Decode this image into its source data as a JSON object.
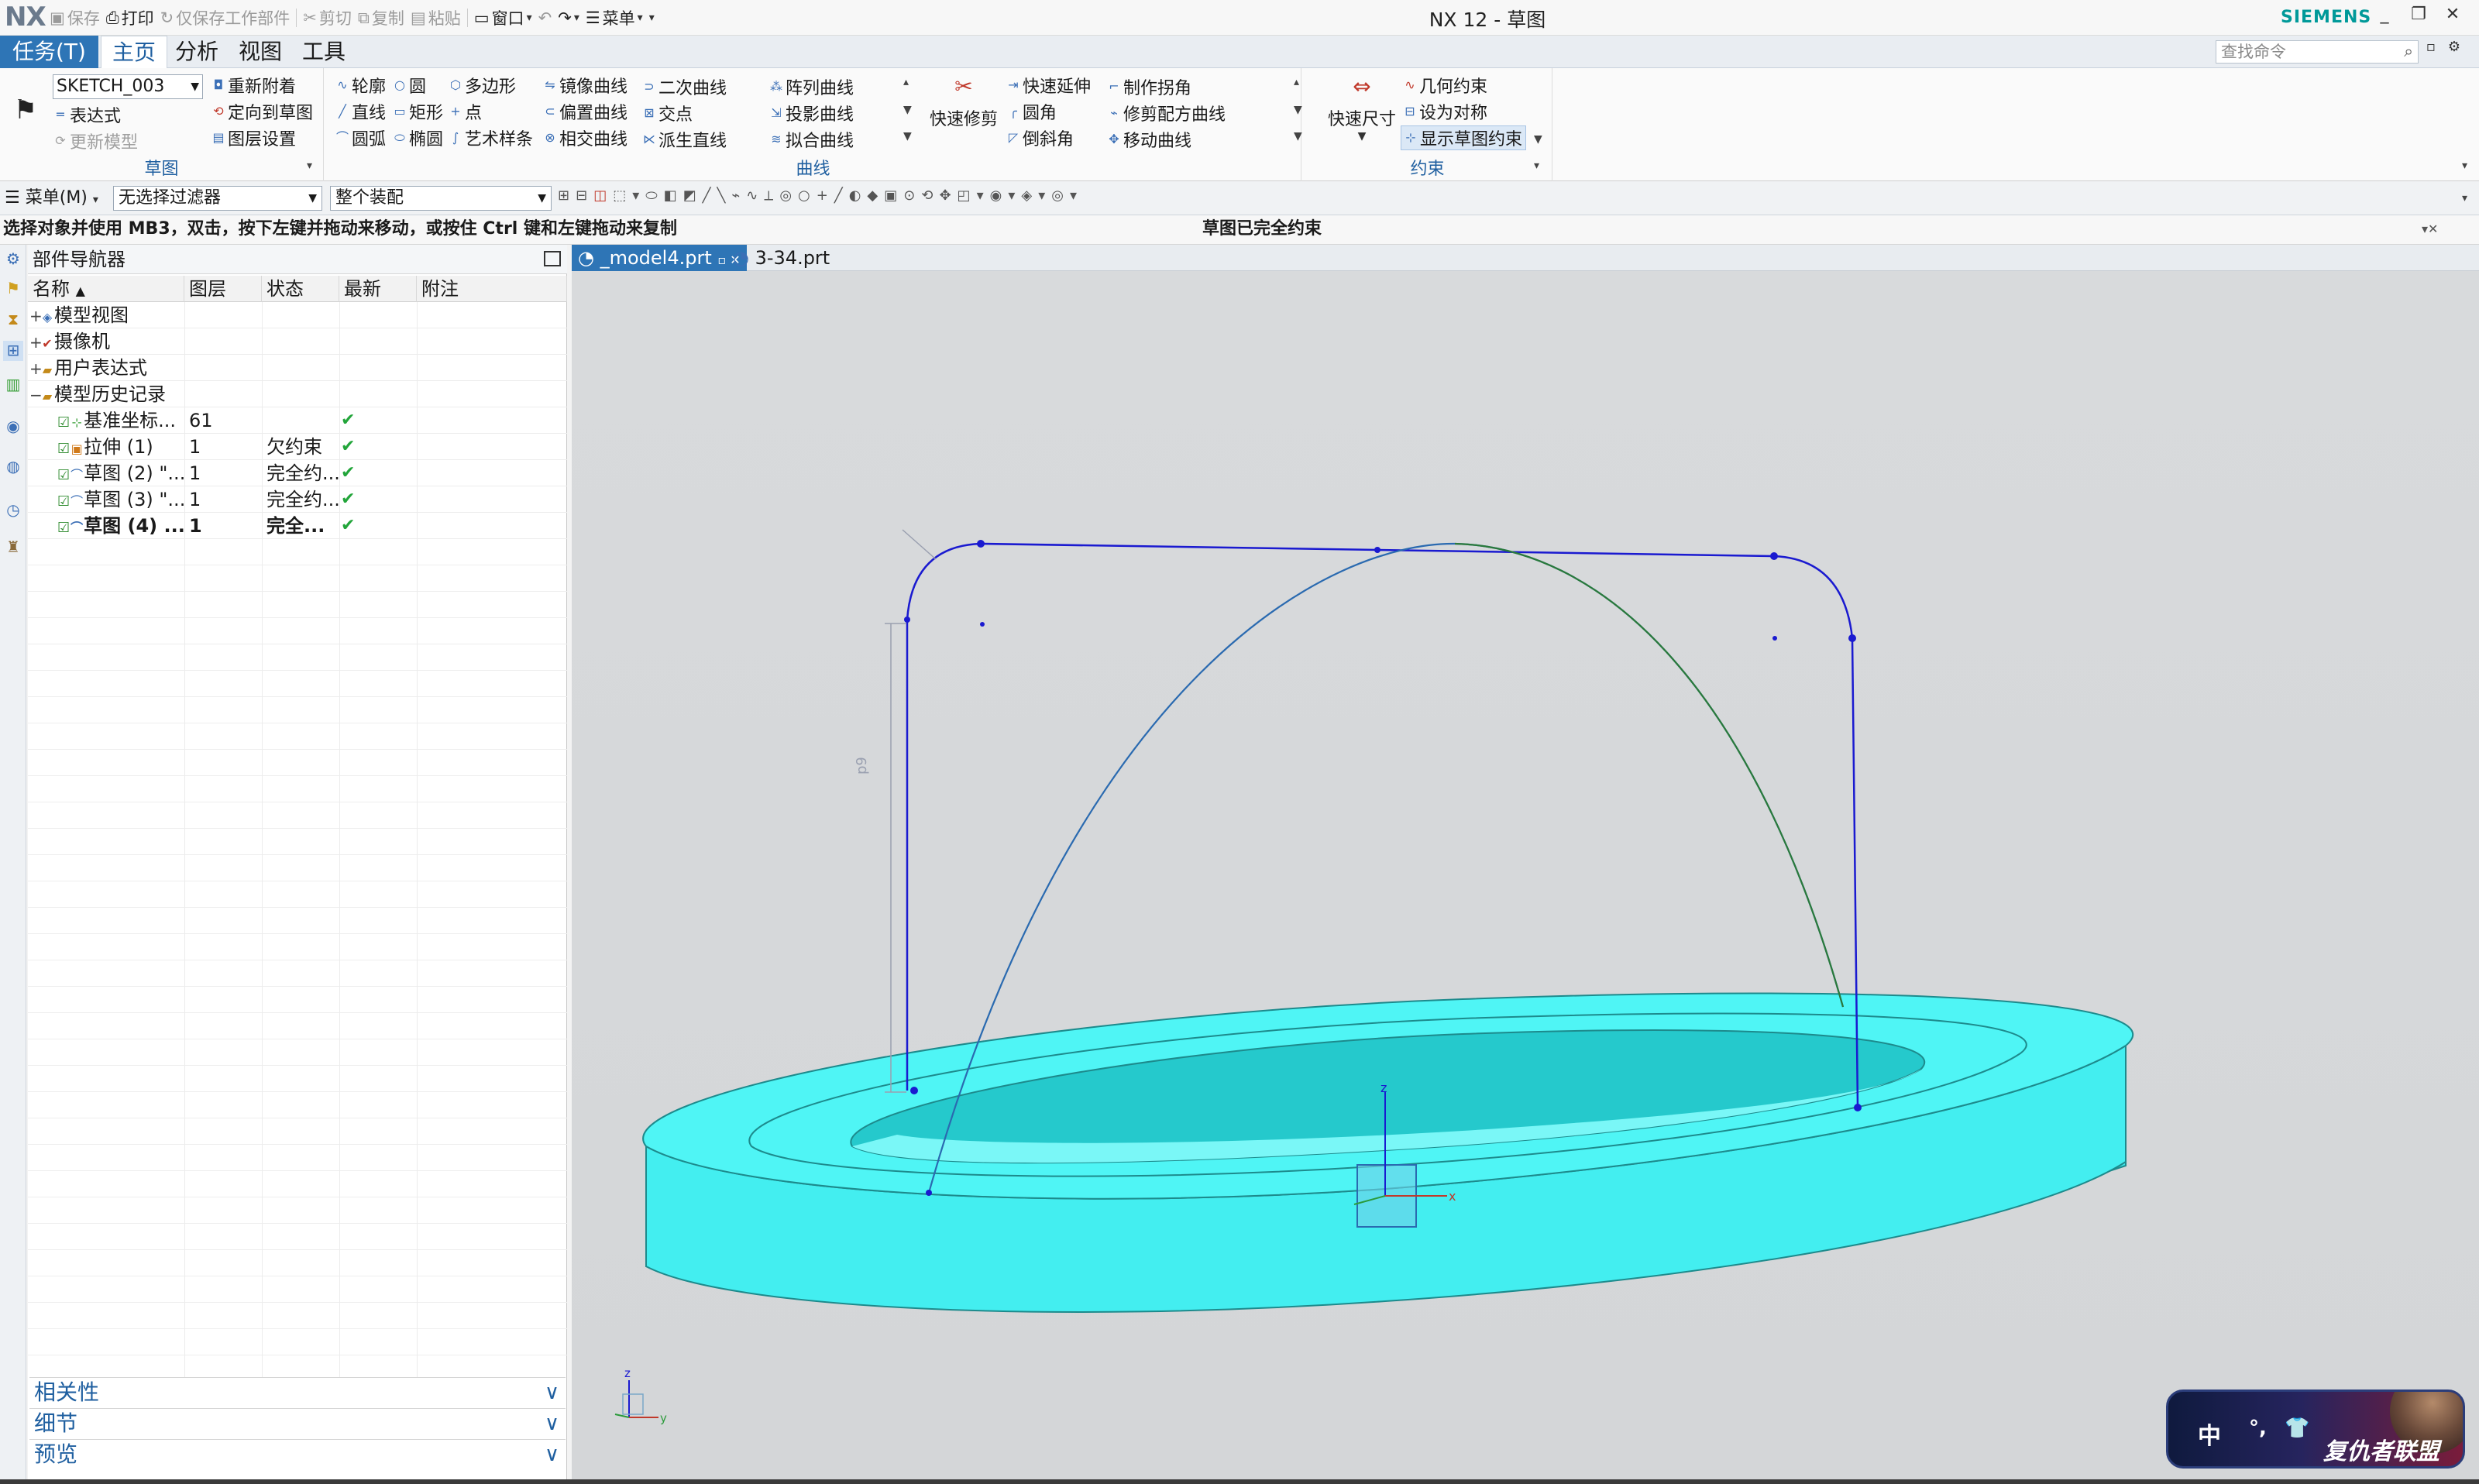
{
  "titlebar": {
    "logo": "NX",
    "qat": {
      "save": "保存",
      "print": "打印",
      "save_work": "仅保存工作部件",
      "cut": "剪切",
      "copy": "复制",
      "paste": "粘贴",
      "window": "窗口",
      "menu": "菜单"
    },
    "title": "NX 12 - 草图",
    "brand": "SIEMENS"
  },
  "tabs": {
    "task": "任务(T)",
    "items": [
      "主页",
      "分析",
      "视图",
      "工具"
    ],
    "active": "主页",
    "search_placeholder": "查找命令"
  },
  "ribbon": {
    "sketch_group": {
      "label": "草图",
      "sketch_name": "SKETCH_003",
      "reattach": "重新附着",
      "expression": "表达式",
      "orient": "定向到草图",
      "update_model": "更新模型",
      "layer": "图层设置"
    },
    "curve_group": {
      "label": "曲线",
      "profile": "轮廓",
      "circle": "圆",
      "polygon": "多边形",
      "line": "直线",
      "rectangle": "矩形",
      "point": "点",
      "arc": "圆弧",
      "ellipse": "椭圆",
      "spline": "艺术样条",
      "mirror": "镜像曲线",
      "offset": "偏置曲线",
      "intersect": "相交曲线",
      "conic": "二次曲线",
      "intersection_point": "交点",
      "derived": "派生直线",
      "pattern": "阵列曲线",
      "project": "投影曲线",
      "fit": "拟合曲线",
      "quick_trim": "快速修剪",
      "quick_extend": "快速延伸",
      "fillet": "圆角",
      "chamfer": "倒斜角",
      "make_corner": "制作拐角",
      "trim_recipe": "修剪配方曲线",
      "move_curve": "移动曲线"
    },
    "constraint_group": {
      "label": "约束",
      "rapid_dim": "快速尺寸",
      "geometric": "几何约束",
      "symmetric": "设为对称",
      "show_constraints": "显示草图约束"
    }
  },
  "selbar": {
    "menu": "菜单(M)",
    "filter": "无选择过滤器",
    "scope": "整个装配"
  },
  "status": {
    "prompt": "选择对象并使用 MB3，双击，按下左键并拖动来移动，或按住 Ctrl 键和左键拖动来复制",
    "message": "草图已完全约束"
  },
  "navigator": {
    "title": "部件导航器",
    "columns": [
      "名称",
      "图层",
      "状态",
      "最新",
      "附注"
    ],
    "rows": [
      {
        "toggle": "+",
        "name": "模型视图",
        "layer": "",
        "state": "",
        "latest": ""
      },
      {
        "toggle": "+",
        "name": "摄像机",
        "layer": "",
        "state": "",
        "latest": ""
      },
      {
        "toggle": "+",
        "name": "用户表达式",
        "layer": "",
        "state": "",
        "latest": ""
      },
      {
        "toggle": "−",
        "name": "模型历史记录",
        "layer": "",
        "state": "",
        "latest": ""
      },
      {
        "toggle": "",
        "name": "基准坐标...",
        "layer": "61",
        "state": "",
        "latest": "✔"
      },
      {
        "toggle": "",
        "name": "拉伸 (1)",
        "layer": "1",
        "state": "欠约束",
        "latest": "✔"
      },
      {
        "toggle": "",
        "name": "草图 (2) \"...",
        "layer": "1",
        "state": "完全约...",
        "latest": "✔"
      },
      {
        "toggle": "",
        "name": "草图 (3) \"...",
        "layer": "1",
        "state": "完全约...",
        "latest": "✔"
      },
      {
        "toggle": "",
        "name": "草图 (4) ...",
        "layer": "1",
        "state": "完全...",
        "latest": "✔"
      }
    ],
    "panels": [
      "相关性",
      "细节",
      "预览"
    ]
  },
  "docs": {
    "tabs": [
      "_model4.prt",
      "3-34.prt"
    ],
    "active": "_model4.prt"
  },
  "viewport": {
    "dim_label": "p9",
    "triad": {
      "x": "x",
      "y": "y",
      "z": "z"
    },
    "part_color": "#4ff5f5",
    "sketch_color": "#1a1ad0",
    "curve_color": "#2a7a3a"
  },
  "ime": {
    "lang": "中",
    "logo": "复仇者联盟"
  }
}
